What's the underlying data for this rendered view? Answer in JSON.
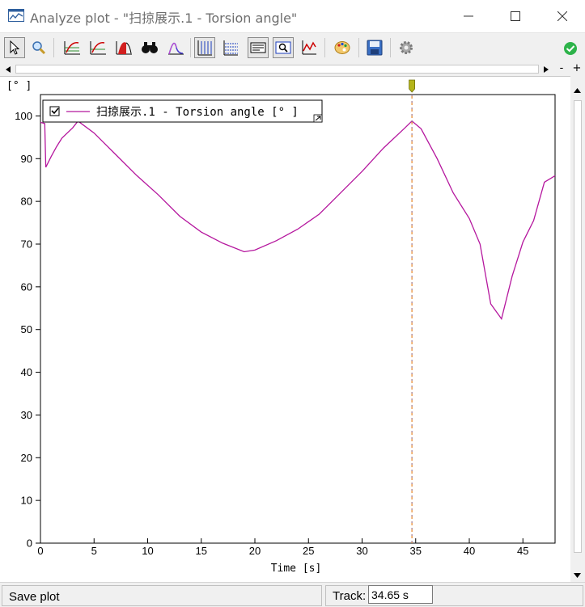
{
  "window": {
    "title": "Analyze plot - \"扫掠展示.1 - Torsion angle\"",
    "minimize_label": "minimize",
    "maximize_label": "maximize",
    "close_label": "close"
  },
  "toolbar": {
    "buttons": [
      {
        "name": "select-pointer-icon",
        "pressed": true
      },
      {
        "name": "magnifier-icon",
        "pressed": false
      },
      {
        "name": "curve-fit-icon",
        "pressed": false
      },
      {
        "name": "curve-fit-alt-icon",
        "pressed": false
      },
      {
        "name": "area-fill-icon",
        "pressed": false
      },
      {
        "name": "binoculars-icon",
        "pressed": false
      },
      {
        "name": "peak-icon",
        "pressed": false
      },
      {
        "name": "vertical-grid-icon",
        "pressed": true
      },
      {
        "name": "horizontal-grid-icon",
        "pressed": false
      },
      {
        "name": "legend-icon",
        "pressed": true
      },
      {
        "name": "zoom-window-icon",
        "pressed": true
      },
      {
        "name": "axis-chart-icon",
        "pressed": false
      },
      {
        "name": "palette-icon",
        "pressed": false
      },
      {
        "name": "save-disk-icon",
        "pressed": false
      },
      {
        "name": "gear-icon",
        "pressed": false
      }
    ],
    "status_icon": "check-circle-icon",
    "status_color": "#2db34a"
  },
  "scroll": {
    "zoom_minus": "-",
    "zoom_plus": "+"
  },
  "chart_data": {
    "type": "line",
    "title": "",
    "xlabel": "Time [s]",
    "ylabel": "[° ]",
    "xlim": [
      0,
      48
    ],
    "ylim": [
      0,
      105
    ],
    "x_ticks": [
      "0",
      "5",
      "10",
      "15",
      "20",
      "25",
      "30",
      "35",
      "40",
      "45"
    ],
    "y_ticks": [
      "0",
      "10",
      "20",
      "30",
      "40",
      "50",
      "60",
      "70",
      "80",
      "90",
      "100"
    ],
    "grid": false,
    "legend_position": "top-left",
    "track_cursor_x": 34.65,
    "series": [
      {
        "name": "扫掠展示.1 - Torsion angle [° ]",
        "color": "#b5179e",
        "x": [
          0,
          0.4,
          0.5,
          1,
          1.5,
          2,
          3,
          3.5,
          5,
          7,
          9,
          11,
          13,
          15,
          17,
          19,
          20,
          22,
          24,
          26,
          28,
          30,
          32,
          34,
          34.65,
          35.5,
          37,
          38.5,
          40,
          41,
          42,
          43,
          44,
          45,
          46,
          47,
          48
        ],
        "y": [
          98.5,
          98.2,
          88,
          90.5,
          92.8,
          94.8,
          97.2,
          98.8,
          96,
          91,
          86,
          81.5,
          76.5,
          72.8,
          70.2,
          68.2,
          68.6,
          70.8,
          73.5,
          77,
          82,
          87,
          92.5,
          97.2,
          98.8,
          97,
          90,
          82,
          76,
          70,
          56,
          52.5,
          62.5,
          70.5,
          75.5,
          84.5,
          86
        ]
      }
    ]
  },
  "legend": {
    "checked": true,
    "label": "扫掠展示.1 - Torsion angle [° ]",
    "expand_icon": "expand-arrow-icon"
  },
  "statusbar": {
    "message": "Save plot",
    "track_label": "Track:",
    "track_value": "34.65 s"
  }
}
